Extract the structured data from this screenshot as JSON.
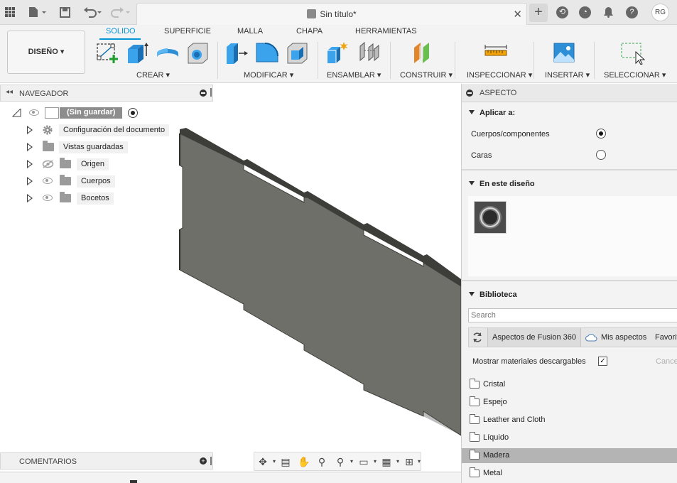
{
  "titlebar": {
    "document_title": "Sin título*",
    "close_tab": "✕",
    "new_tab": "+",
    "user_initials": "RG",
    "icons": [
      "apps-grid-icon",
      "file-menu-icon",
      "save-icon",
      "undo-icon",
      "redo-icon",
      "extensions-icon",
      "job-status-icon",
      "notifications-icon",
      "help-icon"
    ]
  },
  "ribbon": {
    "workspace": "DISEÑO ▾",
    "tabs": [
      "SOLIDO",
      "SUPERFICIE",
      "MALLA",
      "CHAPA",
      "HERRAMIENTAS"
    ],
    "active_tab": "SOLIDO",
    "groups": [
      "CREAR ▾",
      "MODIFICAR ▾",
      "ENSAMBLAR ▾",
      "CONSTRUIR ▾",
      "INSPECCIONAR ▾",
      "INSERTAR ▾",
      "SELECCIONAR ▾"
    ]
  },
  "browser": {
    "title": "NAVEGADOR",
    "root": "(Sin guardar)",
    "items": [
      {
        "label": "Configuración del documento"
      },
      {
        "label": "Vistas guardadas"
      },
      {
        "label": "Origen"
      },
      {
        "label": "Cuerpos"
      },
      {
        "label": "Bocetos"
      }
    ]
  },
  "comments": {
    "title": "COMENTARIOS"
  },
  "appearance": {
    "title": "ASPECTO",
    "apply_to": {
      "title": "Aplicar a:",
      "options": [
        {
          "label": "Cuerpos/componentes",
          "selected": true
        },
        {
          "label": "Caras",
          "selected": false
        }
      ]
    },
    "in_design": {
      "title": "En este diseño"
    },
    "library": {
      "title": "Biblioteca",
      "search_placeholder": "Search",
      "tabs": [
        "Aspectos de Fusion 360",
        "Mis aspectos",
        "Favorit"
      ],
      "show_downloadable": "Mostrar materiales descargables",
      "show_downloadable_checked": true,
      "cancel": "Cance",
      "folders": [
        "Cristal",
        "Espejo",
        "Leather and Cloth",
        "Líquido",
        "Madera",
        "Metal"
      ],
      "selected_folder": "Madera"
    }
  },
  "colors": {
    "accent": "#0696d7",
    "panel_face": "#6e6f69",
    "panel_edge": "#3d3e3a"
  }
}
